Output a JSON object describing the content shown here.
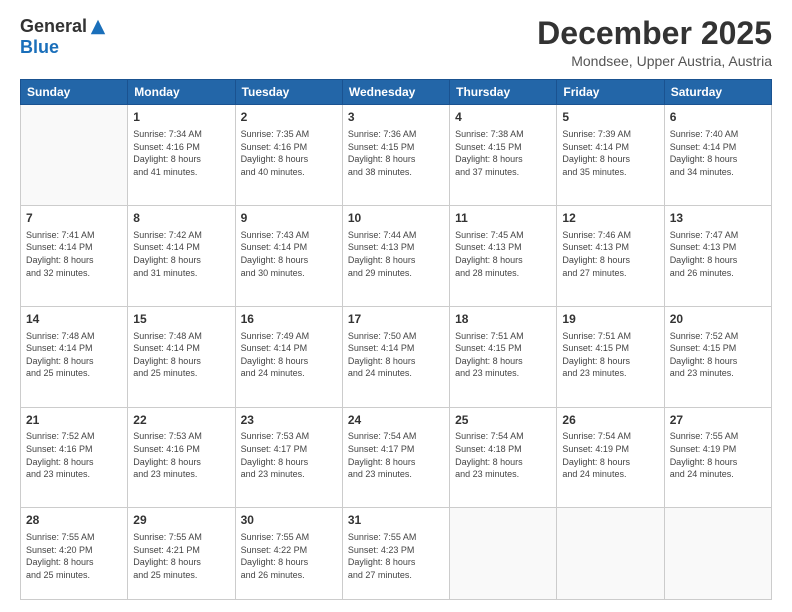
{
  "logo": {
    "general": "General",
    "blue": "Blue"
  },
  "header": {
    "month": "December 2025",
    "location": "Mondsee, Upper Austria, Austria"
  },
  "days": [
    "Sunday",
    "Monday",
    "Tuesday",
    "Wednesday",
    "Thursday",
    "Friday",
    "Saturday"
  ],
  "weeks": [
    [
      {
        "day": "",
        "content": ""
      },
      {
        "day": "1",
        "content": "Sunrise: 7:34 AM\nSunset: 4:16 PM\nDaylight: 8 hours\nand 41 minutes."
      },
      {
        "day": "2",
        "content": "Sunrise: 7:35 AM\nSunset: 4:16 PM\nDaylight: 8 hours\nand 40 minutes."
      },
      {
        "day": "3",
        "content": "Sunrise: 7:36 AM\nSunset: 4:15 PM\nDaylight: 8 hours\nand 38 minutes."
      },
      {
        "day": "4",
        "content": "Sunrise: 7:38 AM\nSunset: 4:15 PM\nDaylight: 8 hours\nand 37 minutes."
      },
      {
        "day": "5",
        "content": "Sunrise: 7:39 AM\nSunset: 4:14 PM\nDaylight: 8 hours\nand 35 minutes."
      },
      {
        "day": "6",
        "content": "Sunrise: 7:40 AM\nSunset: 4:14 PM\nDaylight: 8 hours\nand 34 minutes."
      }
    ],
    [
      {
        "day": "7",
        "content": "Sunrise: 7:41 AM\nSunset: 4:14 PM\nDaylight: 8 hours\nand 32 minutes."
      },
      {
        "day": "8",
        "content": "Sunrise: 7:42 AM\nSunset: 4:14 PM\nDaylight: 8 hours\nand 31 minutes."
      },
      {
        "day": "9",
        "content": "Sunrise: 7:43 AM\nSunset: 4:14 PM\nDaylight: 8 hours\nand 30 minutes."
      },
      {
        "day": "10",
        "content": "Sunrise: 7:44 AM\nSunset: 4:13 PM\nDaylight: 8 hours\nand 29 minutes."
      },
      {
        "day": "11",
        "content": "Sunrise: 7:45 AM\nSunset: 4:13 PM\nDaylight: 8 hours\nand 28 minutes."
      },
      {
        "day": "12",
        "content": "Sunrise: 7:46 AM\nSunset: 4:13 PM\nDaylight: 8 hours\nand 27 minutes."
      },
      {
        "day": "13",
        "content": "Sunrise: 7:47 AM\nSunset: 4:13 PM\nDaylight: 8 hours\nand 26 minutes."
      }
    ],
    [
      {
        "day": "14",
        "content": "Sunrise: 7:48 AM\nSunset: 4:14 PM\nDaylight: 8 hours\nand 25 minutes."
      },
      {
        "day": "15",
        "content": "Sunrise: 7:48 AM\nSunset: 4:14 PM\nDaylight: 8 hours\nand 25 minutes."
      },
      {
        "day": "16",
        "content": "Sunrise: 7:49 AM\nSunset: 4:14 PM\nDaylight: 8 hours\nand 24 minutes."
      },
      {
        "day": "17",
        "content": "Sunrise: 7:50 AM\nSunset: 4:14 PM\nDaylight: 8 hours\nand 24 minutes."
      },
      {
        "day": "18",
        "content": "Sunrise: 7:51 AM\nSunset: 4:15 PM\nDaylight: 8 hours\nand 23 minutes."
      },
      {
        "day": "19",
        "content": "Sunrise: 7:51 AM\nSunset: 4:15 PM\nDaylight: 8 hours\nand 23 minutes."
      },
      {
        "day": "20",
        "content": "Sunrise: 7:52 AM\nSunset: 4:15 PM\nDaylight: 8 hours\nand 23 minutes."
      }
    ],
    [
      {
        "day": "21",
        "content": "Sunrise: 7:52 AM\nSunset: 4:16 PM\nDaylight: 8 hours\nand 23 minutes."
      },
      {
        "day": "22",
        "content": "Sunrise: 7:53 AM\nSunset: 4:16 PM\nDaylight: 8 hours\nand 23 minutes."
      },
      {
        "day": "23",
        "content": "Sunrise: 7:53 AM\nSunset: 4:17 PM\nDaylight: 8 hours\nand 23 minutes."
      },
      {
        "day": "24",
        "content": "Sunrise: 7:54 AM\nSunset: 4:17 PM\nDaylight: 8 hours\nand 23 minutes."
      },
      {
        "day": "25",
        "content": "Sunrise: 7:54 AM\nSunset: 4:18 PM\nDaylight: 8 hours\nand 23 minutes."
      },
      {
        "day": "26",
        "content": "Sunrise: 7:54 AM\nSunset: 4:19 PM\nDaylight: 8 hours\nand 24 minutes."
      },
      {
        "day": "27",
        "content": "Sunrise: 7:55 AM\nSunset: 4:19 PM\nDaylight: 8 hours\nand 24 minutes."
      }
    ],
    [
      {
        "day": "28",
        "content": "Sunrise: 7:55 AM\nSunset: 4:20 PM\nDaylight: 8 hours\nand 25 minutes."
      },
      {
        "day": "29",
        "content": "Sunrise: 7:55 AM\nSunset: 4:21 PM\nDaylight: 8 hours\nand 25 minutes."
      },
      {
        "day": "30",
        "content": "Sunrise: 7:55 AM\nSunset: 4:22 PM\nDaylight: 8 hours\nand 26 minutes."
      },
      {
        "day": "31",
        "content": "Sunrise: 7:55 AM\nSunset: 4:23 PM\nDaylight: 8 hours\nand 27 minutes."
      },
      {
        "day": "",
        "content": ""
      },
      {
        "day": "",
        "content": ""
      },
      {
        "day": "",
        "content": ""
      }
    ]
  ]
}
